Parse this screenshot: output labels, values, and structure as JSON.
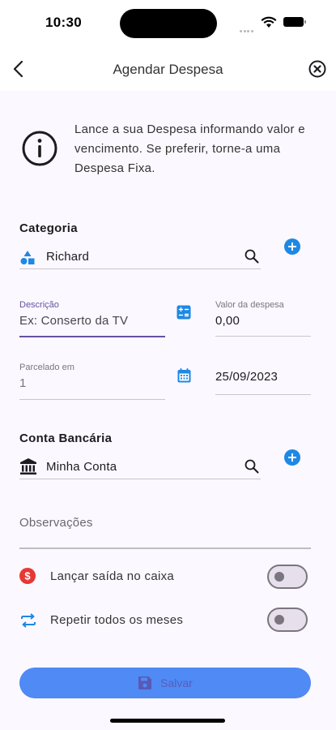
{
  "status_bar": {
    "time": "10:30"
  },
  "header": {
    "title": "Agendar Despesa"
  },
  "info": {
    "text": "Lance a sua Despesa informando valor e vencimento. Se preferir, torne-a uma Despesa Fixa."
  },
  "categoria": {
    "title": "Categoria",
    "value": "Richard"
  },
  "descricao": {
    "label": "Descrição",
    "placeholder": "Ex: Conserto da TV"
  },
  "valor": {
    "label": "Valor da despesa",
    "value": "0,00"
  },
  "parcelado": {
    "label": "Parcelado em",
    "value": "1"
  },
  "vencimento": {
    "value": "25/09/2023"
  },
  "conta": {
    "title": "Conta Bancária",
    "value": "Minha Conta"
  },
  "observacoes": {
    "placeholder": "Observações"
  },
  "toggles": [
    {
      "label": "Lançar saída no caixa",
      "on": false
    },
    {
      "label": "Repetir todos os meses",
      "on": false
    }
  ],
  "save": {
    "label": "Salvar"
  },
  "colors": {
    "accent": "#1e88e5",
    "primary_button": "#4f8af5",
    "focus": "#6750a4",
    "danger": "#e53935"
  }
}
